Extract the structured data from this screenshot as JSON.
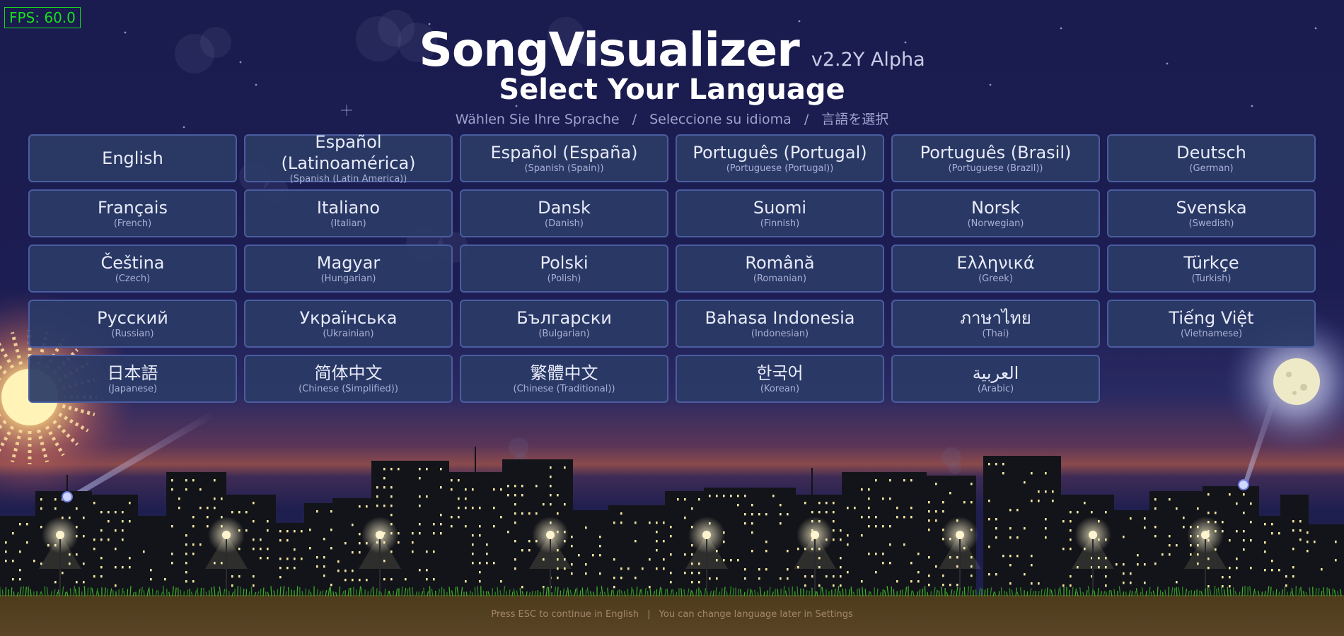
{
  "hud": {
    "fps": "FPS: 60.0"
  },
  "header": {
    "title": "SongVisualizer",
    "version": "v2.2Y Alpha",
    "subtitle": "Select Your Language",
    "translations": [
      "Wählen Sie Ihre Sprache",
      "Seleccione su idioma",
      "言語を選択"
    ],
    "separator": "/"
  },
  "languages": [
    {
      "native": "English",
      "english": ""
    },
    {
      "native": "Español (Latinoamérica)",
      "english": "(Spanish (Latin America))"
    },
    {
      "native": "Español (España)",
      "english": "(Spanish (Spain))"
    },
    {
      "native": "Português (Portugal)",
      "english": "(Portuguese (Portugal))"
    },
    {
      "native": "Português (Brasil)",
      "english": "(Portuguese (Brazil))"
    },
    {
      "native": "Deutsch",
      "english": "(German)"
    },
    {
      "native": "Français",
      "english": "(French)"
    },
    {
      "native": "Italiano",
      "english": "(Italian)"
    },
    {
      "native": "Dansk",
      "english": "(Danish)"
    },
    {
      "native": "Suomi",
      "english": "(Finnish)"
    },
    {
      "native": "Norsk",
      "english": "(Norwegian)"
    },
    {
      "native": "Svenska",
      "english": "(Swedish)"
    },
    {
      "native": "Čeština",
      "english": "(Czech)"
    },
    {
      "native": "Magyar",
      "english": "(Hungarian)"
    },
    {
      "native": "Polski",
      "english": "(Polish)"
    },
    {
      "native": "Română",
      "english": "(Romanian)"
    },
    {
      "native": "Ελληνικά",
      "english": "(Greek)"
    },
    {
      "native": "Türkçe",
      "english": "(Turkish)"
    },
    {
      "native": "Русский",
      "english": "(Russian)"
    },
    {
      "native": "Українська",
      "english": "(Ukrainian)"
    },
    {
      "native": "Български",
      "english": "(Bulgarian)"
    },
    {
      "native": "Bahasa Indonesia",
      "english": "(Indonesian)"
    },
    {
      "native": "ภาษาไทย",
      "english": "(Thai)"
    },
    {
      "native": "Tiếng Việt",
      "english": "(Vietnamese)"
    },
    {
      "native": "日本語",
      "english": "(Japanese)"
    },
    {
      "native": "简体中文",
      "english": "(Chinese (Simplified))"
    },
    {
      "native": "繁體中文",
      "english": "(Chinese (Traditional))"
    },
    {
      "native": "한국어",
      "english": "(Korean)"
    },
    {
      "native": "العربية",
      "english": "(Arabic)"
    }
  ],
  "footer": {
    "left": "Press ESC to continue in English",
    "right": "You can change language later in Settings",
    "separator": "|"
  },
  "colors": {
    "sky": "#1b1c4d",
    "button_bg": "#2b3a66",
    "button_border": "#4a5da0",
    "fps": "#18e01e",
    "ground": "#4a3a1e",
    "grass": "#3fae2c",
    "window_light": "#f3e5a0"
  },
  "icons": {
    "sun": "sun-icon",
    "moon": "moon-icon"
  }
}
